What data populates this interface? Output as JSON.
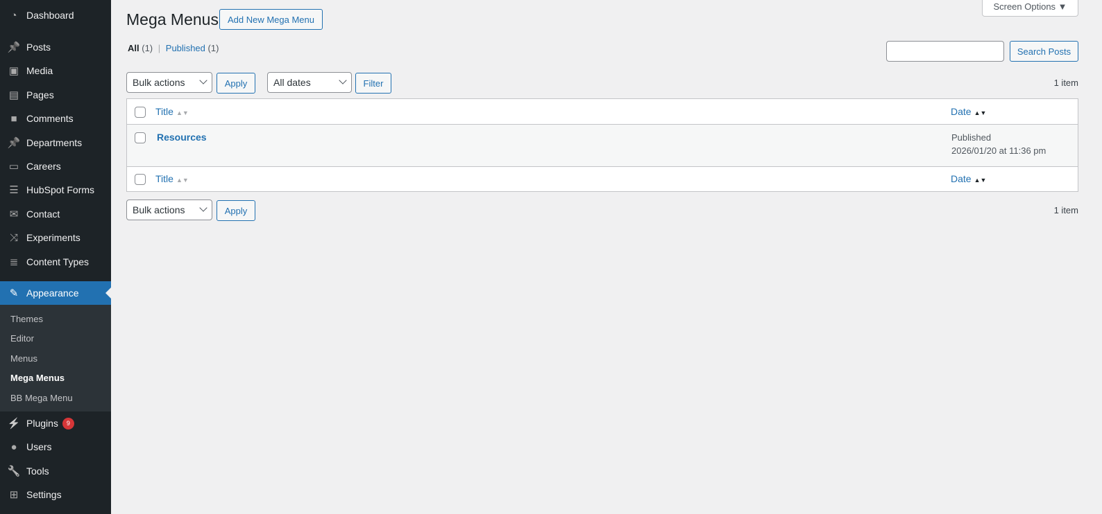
{
  "sidebar": {
    "items": [
      {
        "label": "Dashboard",
        "icon": "dashboard-icon"
      },
      {
        "label": "Posts",
        "icon": "pin-icon"
      },
      {
        "label": "Media",
        "icon": "media-icon"
      },
      {
        "label": "Pages",
        "icon": "pages-icon"
      },
      {
        "label": "Comments",
        "icon": "comment-icon"
      },
      {
        "label": "Departments",
        "icon": "pin-icon"
      },
      {
        "label": "Careers",
        "icon": "id-card-icon"
      },
      {
        "label": "HubSpot Forms",
        "icon": "form-icon"
      },
      {
        "label": "Contact",
        "icon": "mail-icon"
      },
      {
        "label": "Experiments",
        "icon": "shuffle-icon"
      },
      {
        "label": "Content Types",
        "icon": "database-icon"
      },
      {
        "label": "Appearance",
        "icon": "paintbrush-icon"
      },
      {
        "label": "Plugins",
        "icon": "plug-icon",
        "badge": "9"
      },
      {
        "label": "Users",
        "icon": "user-icon"
      },
      {
        "label": "Tools",
        "icon": "wrench-icon"
      },
      {
        "label": "Settings",
        "icon": "settings-icon"
      }
    ],
    "submenu": [
      "Themes",
      "Editor",
      "Menus",
      "Mega Menus",
      "BB Mega Menu"
    ]
  },
  "header": {
    "title": "Mega Menus",
    "add_new": "Add New Mega Menu",
    "screen_options": "Screen Options ▼"
  },
  "views": {
    "all": "All",
    "all_count": "(1)",
    "sep": "|",
    "published": "Published",
    "published_count": "(1)"
  },
  "search": {
    "value": "",
    "button": "Search Posts"
  },
  "toolbar": {
    "bulk": "Bulk actions",
    "apply": "Apply",
    "dates": "All dates",
    "filter": "Filter",
    "count": "1 item"
  },
  "table": {
    "col_title": "Title",
    "col_date": "Date",
    "rows": [
      {
        "title": "Resources",
        "status": "Published",
        "date": "2026/01/20 at 11:36 pm"
      }
    ]
  },
  "colors": {
    "sidebar": "#1d2327",
    "accent": "#2271b1",
    "badge": "#d63638"
  }
}
